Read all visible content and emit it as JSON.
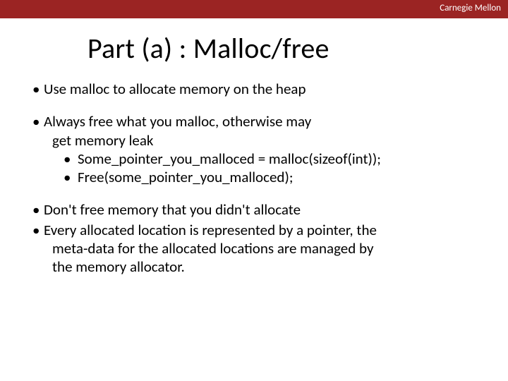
{
  "header": {
    "brand": "Carnegie Mellon"
  },
  "title": "Part (a) : Malloc/free",
  "bullets": [
    {
      "text": "Use malloc to allocate memory on the heap"
    },
    {
      "text": "Always free what you malloc, otherwise may",
      "text2": "get memory leak",
      "sub": [
        "Some_pointer_you_malloced = malloc(sizeof(int));",
        "Free(some_pointer_you_malloced);"
      ]
    },
    {
      "text": "Don't free memory that you didn't allocate"
    },
    {
      "text": "Every allocated location is represented by a pointer, the",
      "text2": "meta-data for the allocated locations are managed by",
      "text3": "the memory allocator."
    }
  ]
}
